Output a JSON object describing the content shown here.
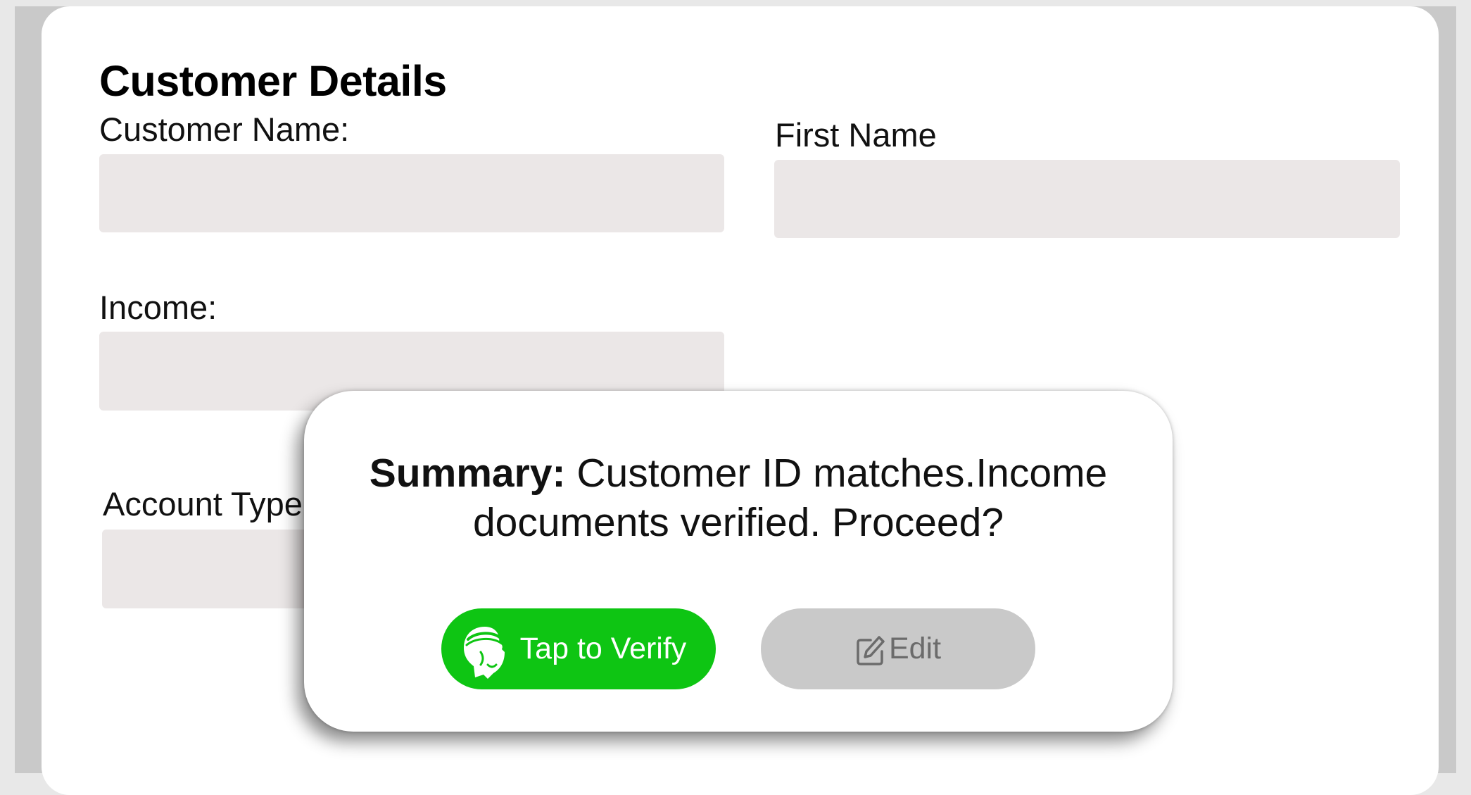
{
  "form": {
    "title": "Customer Details",
    "fields": {
      "customer_name": {
        "label": "Customer Name:",
        "value": ""
      },
      "first_name": {
        "label": "First Name",
        "value": ""
      },
      "income": {
        "label": "Income:",
        "value": ""
      },
      "account_type": {
        "label": "Account Type",
        "value": ""
      }
    }
  },
  "modal": {
    "summary_label": "Summary:",
    "summary_text": "Customer ID matches.Income documents verified. Proceed?",
    "verify_button": {
      "label": "Tap to Verify",
      "icon": "verify-face-icon",
      "color": "#0ec513"
    },
    "edit_button": {
      "label": "Edit",
      "icon": "edit-pencil-icon",
      "color": "#c9c9c9"
    }
  }
}
